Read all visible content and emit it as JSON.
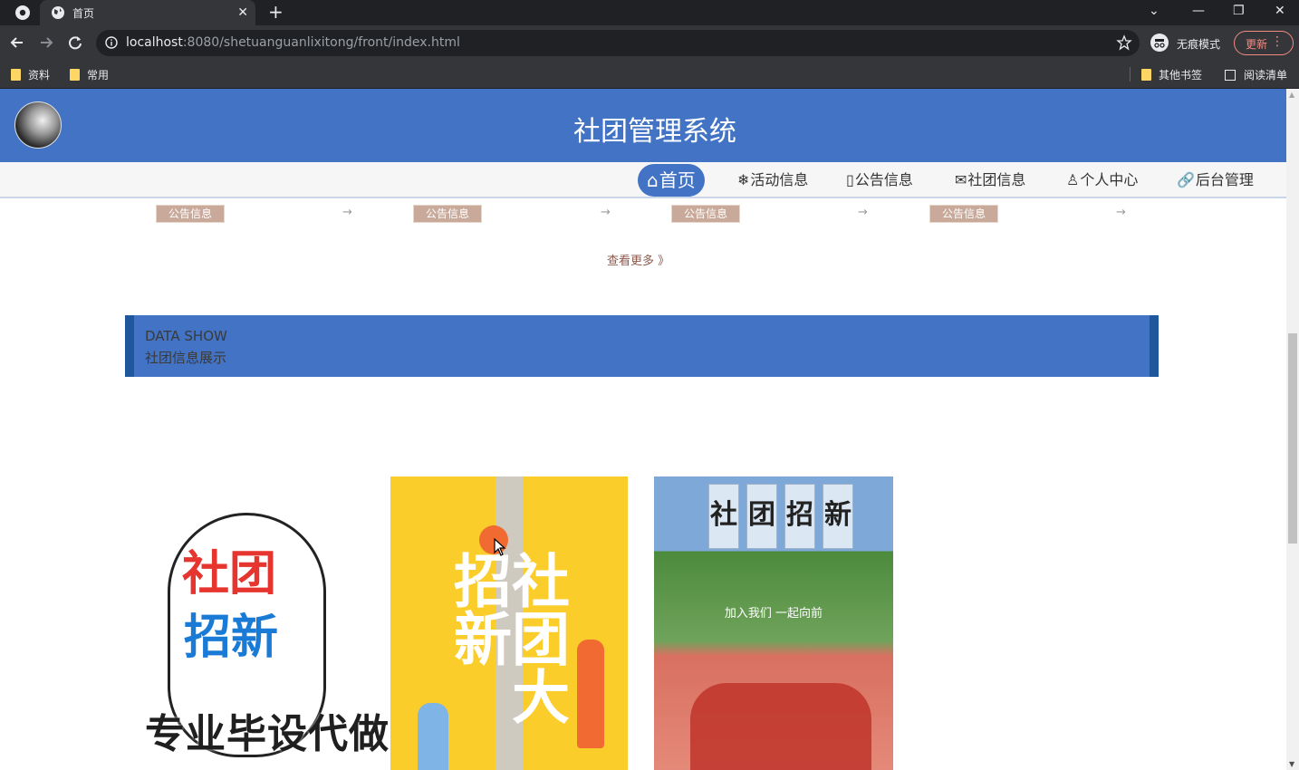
{
  "browser": {
    "tab_title": "首页",
    "url_host": "localhost",
    "url_rest": ":8080/shetuanguanlixitong/front/index.html",
    "incognito_label": "无痕模式",
    "update_label": "更新",
    "bookmarks": [
      "资料",
      "常用"
    ],
    "bookmarks_right": [
      "其他书签",
      "阅读清单"
    ]
  },
  "site": {
    "title": "社团管理系统",
    "nav": [
      {
        "icon": "⌂",
        "label": "首页",
        "active": true
      },
      {
        "icon": "❄",
        "label": "活动信息"
      },
      {
        "icon": "▯",
        "label": "公告信息"
      },
      {
        "icon": "✉",
        "label": "社团信息"
      },
      {
        "icon": "♙",
        "label": "个人中心"
      },
      {
        "icon": "🔗",
        "label": "后台管理"
      }
    ]
  },
  "notices": {
    "tags": [
      "公告信息",
      "公告信息",
      "公告信息",
      "公告信息"
    ],
    "more_label": "查看更多 》"
  },
  "data_show": {
    "en_title": "DATA SHOW",
    "cn_title": "社团信息展示"
  },
  "cards": {
    "card1": {
      "line1": "社团",
      "line2": "招新"
    },
    "card2": {
      "text": "社团大招新"
    },
    "card3": {
      "signs": [
        "社",
        "团",
        "招",
        "新"
      ],
      "subtitle": "加入我们 一起向前"
    }
  },
  "watermark": "专业毕设代做",
  "colors": {
    "brand_blue": "#4373c4",
    "banner_edge": "#1f579d",
    "browser_dark": "#202124"
  }
}
